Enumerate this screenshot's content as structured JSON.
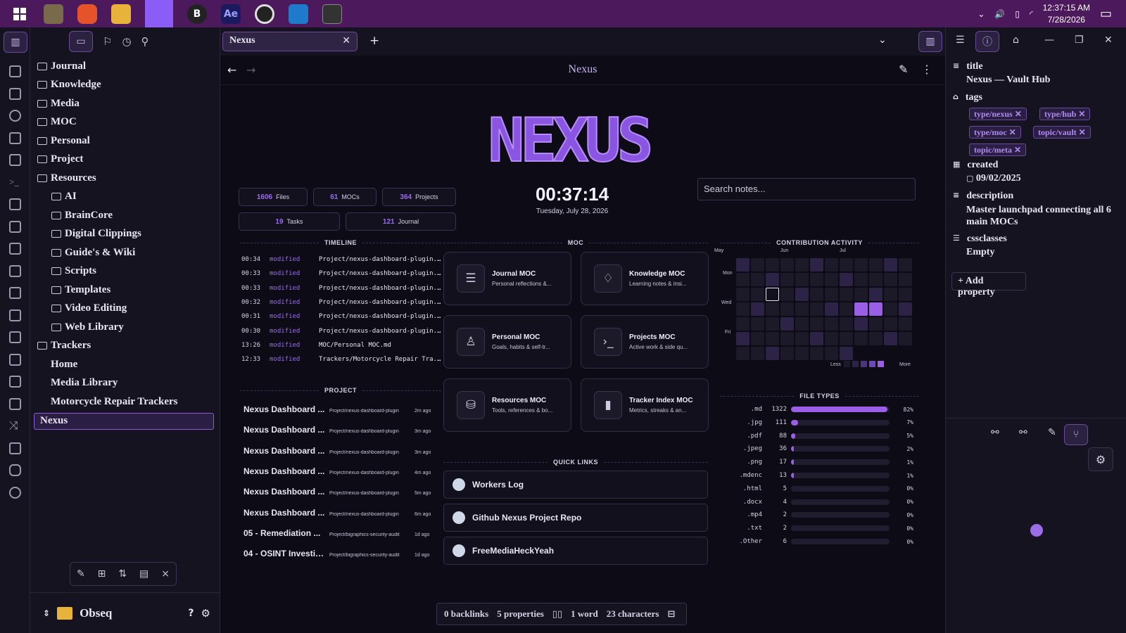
{
  "taskbar": {
    "time": "12:37:15 AM",
    "date": "7/28/2026",
    "apps": [
      "start-icon",
      "gimp-icon",
      "brave-icon",
      "files-icon",
      "obsidian-icon",
      "bitwarden-icon",
      "after-effects-icon",
      "obs-icon",
      "vscode-icon",
      "terminal-icon"
    ],
    "ae_label": "Ae",
    "b_label": "B"
  },
  "leftpane": {
    "tree": [
      {
        "label": "Journal",
        "type": "folder"
      },
      {
        "label": "Knowledge",
        "type": "folder"
      },
      {
        "label": "Media",
        "type": "folder"
      },
      {
        "label": "MOC",
        "type": "folder"
      },
      {
        "label": "Personal",
        "type": "folder"
      },
      {
        "label": "Project",
        "type": "folder"
      },
      {
        "label": "Resources",
        "type": "folder-open"
      },
      {
        "label": "AI",
        "type": "folder",
        "indent": 1
      },
      {
        "label": "BrainCore",
        "type": "folder",
        "indent": 1
      },
      {
        "label": "Digital Clippings",
        "type": "folder",
        "indent": 1
      },
      {
        "label": "Guide's & Wiki",
        "type": "folder",
        "indent": 1
      },
      {
        "label": "Scripts",
        "type": "folder",
        "indent": 1
      },
      {
        "label": "Templates",
        "type": "folder",
        "indent": 1
      },
      {
        "label": "Video Editing",
        "type": "folder",
        "indent": 1
      },
      {
        "label": "Web Library",
        "type": "folder",
        "indent": 1
      },
      {
        "label": "Trackers",
        "type": "folder-open"
      },
      {
        "label": "Home",
        "type": "file",
        "indent": 1
      },
      {
        "label": "Media Library",
        "type": "file",
        "indent": 1
      },
      {
        "label": "Motorcycle Repair Trackers",
        "type": "file",
        "indent": 1
      },
      {
        "label": "Nexus",
        "type": "file",
        "selected": true
      }
    ],
    "vault_name": "Obseq"
  },
  "tab": {
    "title": "Nexus"
  },
  "nav": {
    "title": "Nexus"
  },
  "dashboard": {
    "logo_text": "NEXUS",
    "stats": [
      {
        "value": "1606",
        "label": "Files"
      },
      {
        "value": "61",
        "label": "MOCs"
      },
      {
        "value": "364",
        "label": "Projects"
      },
      {
        "value": "19",
        "label": "Tasks"
      },
      {
        "value": "121",
        "label": "Journal"
      }
    ],
    "clock": "00:37:14",
    "date": "Tuesday, July 28, 2026",
    "search_placeholder": "Search notes...",
    "headers": {
      "timeline": "TIMELINE",
      "moc": "MOC",
      "activity": "CONTRIBUTION ACTIVITY",
      "project": "PROJECT",
      "quick_links": "QUICK LINKS",
      "file_types": "FILE TYPES"
    },
    "timeline": [
      {
        "time": "00:34",
        "action": "modified",
        "path": "Project/nexus-dashboard-plugin..."
      },
      {
        "time": "00:33",
        "action": "modified",
        "path": "Project/nexus-dashboard-plugin..."
      },
      {
        "time": "00:33",
        "action": "modified",
        "path": "Project/nexus-dashboard-plugin..."
      },
      {
        "time": "00:32",
        "action": "modified",
        "path": "Project/nexus-dashboard-plugin..."
      },
      {
        "time": "00:31",
        "action": "modified",
        "path": "Project/nexus-dashboard-plugin..."
      },
      {
        "time": "00:30",
        "action": "modified",
        "path": "Project/nexus-dashboard-plugin..."
      },
      {
        "time": "13:26",
        "action": "modified",
        "path": "MOC/Personal MOC.md"
      },
      {
        "time": "12:33",
        "action": "modified",
        "path": "Trackers/Motorcycle Repair Tra..."
      }
    ],
    "projects": [
      {
        "name": "Nexus Dashboard ...",
        "path": "Project/nexus-dashboard-plugin",
        "ago": "2m ago"
      },
      {
        "name": "Nexus Dashboard ...",
        "path": "Project/nexus-dashboard-plugin",
        "ago": "3m ago"
      },
      {
        "name": "Nexus Dashboard ...",
        "path": "Project/nexus-dashboard-plugin",
        "ago": "3m ago"
      },
      {
        "name": "Nexus Dashboard ...",
        "path": "Project/nexus-dashboard-plugin",
        "ago": "4m ago"
      },
      {
        "name": "Nexus Dashboard ...",
        "path": "Project/nexus-dashboard-plugin",
        "ago": "5m ago"
      },
      {
        "name": "Nexus Dashboard ...",
        "path": "Project/nexus-dashboard-plugin",
        "ago": "6m ago"
      },
      {
        "name": "05 - Remediation ...",
        "path": "Project/bigraphics-security-audit",
        "ago": "1d ago"
      },
      {
        "name": "04 - OSINT Investig...",
        "path": "Project/bigraphics-security-audit",
        "ago": "1d ago"
      }
    ],
    "mocs": [
      {
        "title": "Journal MOC",
        "desc": "Personal reflections &...",
        "icon": "document-icon"
      },
      {
        "title": "Knowledge MOC",
        "desc": "Learning notes & insi...",
        "icon": "lightbulb-icon"
      },
      {
        "title": "Personal MOC",
        "desc": "Goals, habits & self-tr...",
        "icon": "person-icon"
      },
      {
        "title": "Projects MOC",
        "desc": "Active work & side qu...",
        "icon": "terminal-icon"
      },
      {
        "title": "Resources MOC",
        "desc": "Tools, references & bo...",
        "icon": "database-icon"
      },
      {
        "title": "Tracker Index MOC",
        "desc": "Metrics, streaks & an...",
        "icon": "bar-chart-icon"
      }
    ],
    "quick_links": [
      "Workers Log",
      "Github Nexus Project Repo",
      "FreeMediaHeckYeah"
    ],
    "activity": {
      "months": [
        "May",
        "Jun",
        "Jul"
      ],
      "days": [
        "Mon",
        "Wed",
        "Fri"
      ],
      "legend_less": "Less",
      "legend_more": "More"
    },
    "file_types": [
      {
        "ext": ".md",
        "count": "1322",
        "pct": "82%",
        "frac": 0.82
      },
      {
        "ext": ".jpg",
        "count": "111",
        "pct": "7%",
        "frac": 0.07
      },
      {
        "ext": ".pdf",
        "count": "88",
        "pct": "5%",
        "frac": 0.05
      },
      {
        "ext": ".jpeg",
        "count": "36",
        "pct": "2%",
        "frac": 0.02
      },
      {
        "ext": ".png",
        "count": "17",
        "pct": "1%",
        "frac": 0.01
      },
      {
        "ext": ".mdenc",
        "count": "13",
        "pct": "1%",
        "frac": 0.01
      },
      {
        "ext": ".html",
        "count": "5",
        "pct": "0%",
        "frac": 0.0
      },
      {
        "ext": ".docx",
        "count": "4",
        "pct": "0%",
        "frac": 0.0
      },
      {
        "ext": ".mp4",
        "count": "2",
        "pct": "0%",
        "frac": 0.0
      },
      {
        "ext": ".txt",
        "count": "2",
        "pct": "0%",
        "frac": 0.0
      },
      {
        "ext": ".Other",
        "count": "6",
        "pct": "0%",
        "frac": 0.0
      }
    ]
  },
  "status": {
    "backlinks": "0 backlinks",
    "properties": "5 properties",
    "words": "1 word",
    "chars": "23 characters"
  },
  "properties": {
    "title_key": "title",
    "title_val": "Nexus — Vault Hub",
    "tags_key": "tags",
    "tags": [
      "type/nexus",
      "type/hub",
      "type/moc",
      "topic/vault",
      "topic/meta"
    ],
    "created_key": "created",
    "created_val": "09/02/2025",
    "desc_key": "description",
    "desc_val": "Master launchpad connecting all 6 main MOCs",
    "css_key": "cssclasses",
    "css_val": "Empty",
    "add_label": "+ Add property"
  },
  "colors": {
    "accent": "#9b5ee6",
    "taskbar": "#4c1a5c",
    "bg": "#0d0c16"
  }
}
